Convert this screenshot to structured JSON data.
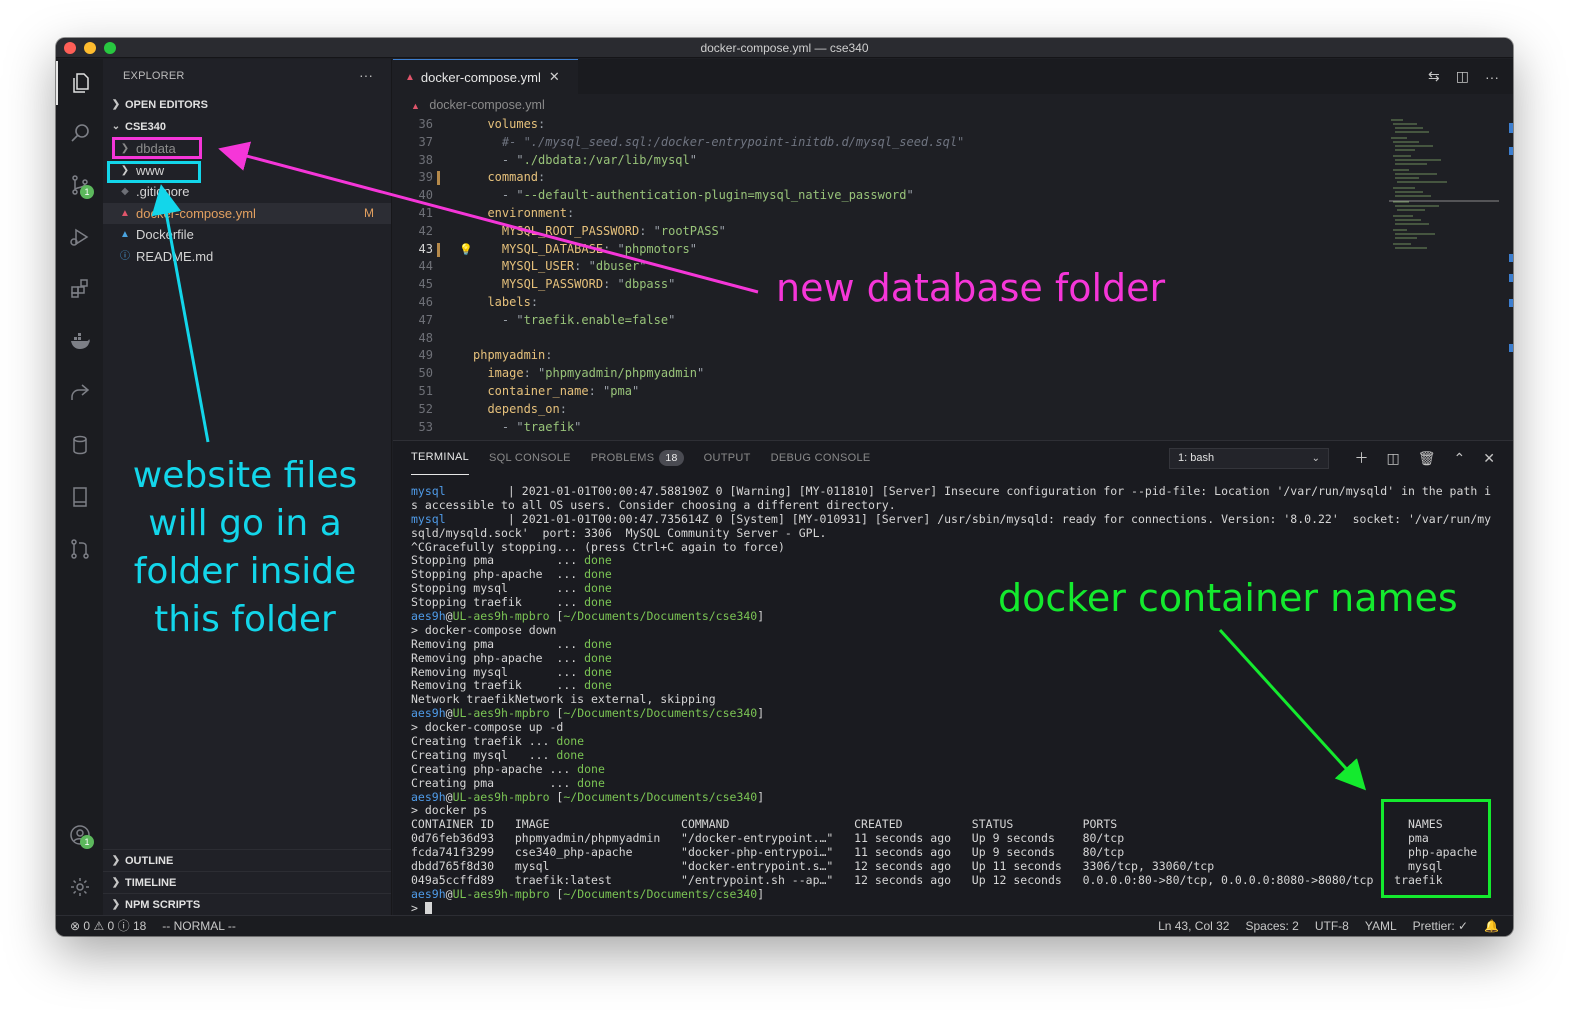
{
  "window": {
    "title": "docker-compose.yml — cse340"
  },
  "sidebar": {
    "title": "EXPLORER",
    "more": "···",
    "open_editors": "OPEN EDITORS",
    "folder": "CSE340",
    "items": [
      {
        "label": "dbdata",
        "type": "folder"
      },
      {
        "label": "www",
        "type": "folder"
      },
      {
        "label": ".gitignore",
        "type": "file"
      },
      {
        "label": "docker-compose.yml",
        "type": "file",
        "badge": "M"
      },
      {
        "label": "Dockerfile",
        "type": "file"
      },
      {
        "label": "README.md",
        "type": "file"
      }
    ],
    "outline": "OUTLINE",
    "timeline": "TIMELINE",
    "npm_scripts": "NPM SCRIPTS"
  },
  "activity_badges": {
    "scm": "1",
    "accounts": "1"
  },
  "editor": {
    "tab": "docker-compose.yml",
    "breadcrumb": "docker-compose.yml",
    "line_numbers": [
      "36",
      "37",
      "38",
      "39",
      "40",
      "41",
      "42",
      "43",
      "44",
      "45",
      "46",
      "47",
      "48",
      "49",
      "50",
      "51",
      "52",
      "53"
    ]
  },
  "panel": {
    "tabs": [
      "TERMINAL",
      "SQL CONSOLE",
      "PROBLEMS",
      "OUTPUT",
      "DEBUG CONSOLE"
    ],
    "problems_count": "18",
    "terminal_select": "1: bash"
  },
  "statusbar": {
    "errors": "0",
    "warnings": "0",
    "infos": "18",
    "mode": "-- NORMAL --",
    "position": "Ln 43, Col 32",
    "spaces": "Spaces: 2",
    "encoding": "UTF-8",
    "language": "YAML",
    "prettier": "Prettier: ✓"
  },
  "annotations": {
    "database": "new database folder",
    "website": [
      "website files",
      "will go in a",
      "folder inside",
      "this folder"
    ],
    "containers": "docker container names",
    "colors": {
      "magenta": "#f536d8",
      "cyan": "#13d6ea",
      "green": "#14ea2e"
    }
  }
}
